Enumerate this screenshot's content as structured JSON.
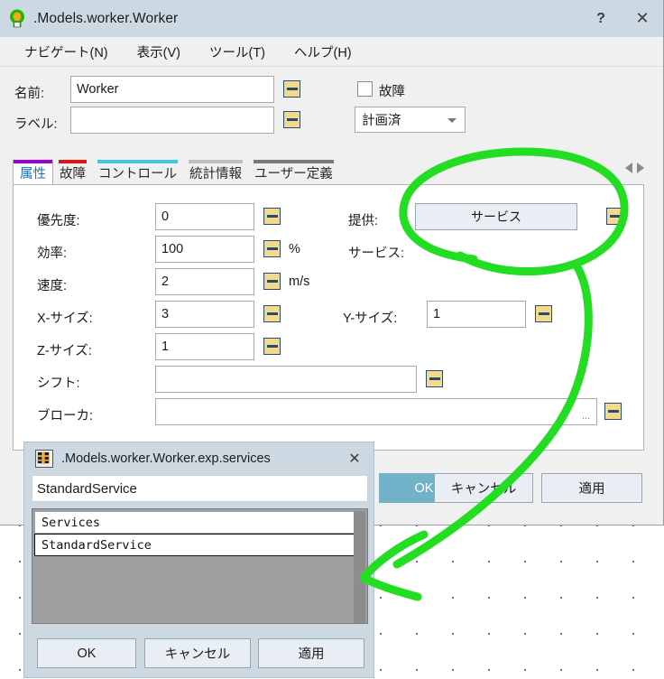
{
  "window": {
    "title": ".Models.worker.Worker",
    "icon": "worker-green-icon",
    "help_label": "?",
    "close_label": "✕"
  },
  "menubar": {
    "items": [
      {
        "label": "ナビゲート(N)"
      },
      {
        "label": "表示(V)"
      },
      {
        "label": "ツール(T)"
      },
      {
        "label": "ヘルプ(H)"
      }
    ]
  },
  "topform": {
    "name_label": "名前:",
    "name_value": "Worker",
    "label_label": "ラベル:",
    "label_value": "",
    "failure_checkbox_label": "故障",
    "failure_checked": false,
    "status_dropdown_value": "計画済"
  },
  "tabs": [
    {
      "label": "属性",
      "color": "#9a00d4",
      "active": true
    },
    {
      "label": "故障",
      "color": "#e81010",
      "active": false
    },
    {
      "label": "コントロール",
      "color": "#44c2e8",
      "active": false
    },
    {
      "label": "統計情報",
      "color": "#bfbfbf",
      "active": false
    },
    {
      "label": "ユーザー定義",
      "color": "#7a7a7a",
      "active": false
    }
  ],
  "tabnav": {
    "prev": "prev-tab",
    "next": "next-tab"
  },
  "attributes": {
    "fields": [
      {
        "label": "優先度:",
        "value": "0",
        "unit": ""
      },
      {
        "label": "効率:",
        "value": "100",
        "unit": "%"
      },
      {
        "label": "速度:",
        "value": "2",
        "unit": "m/s"
      },
      {
        "label": "X-サイズ:",
        "value": "3",
        "unit": ""
      },
      {
        "label": "Z-サイズ:",
        "value": "1",
        "unit": ""
      },
      {
        "label": "シフト:",
        "value": "",
        "unit": ""
      },
      {
        "label": "ブローカ:",
        "value": "",
        "unit": ""
      }
    ],
    "ysize_label": "Y-サイズ:",
    "ysize_value": "1",
    "provide_label": "提供:",
    "provide_button": "サービス",
    "service_label": "サービス:",
    "service_value": "-",
    "broker_ellipsis": "..."
  },
  "main_buttons": {
    "ok": "OK",
    "cancel": "キャンセル",
    "apply": "適用"
  },
  "child_dialog": {
    "icon": "table-grid-icon",
    "title": ".Models.worker.Worker.exp.services",
    "close_label": "✕",
    "input_value": "StandardService",
    "list": [
      {
        "label": "Services",
        "selected": false
      },
      {
        "label": "StandardService",
        "selected": true
      }
    ],
    "buttons": {
      "ok": "OK",
      "cancel": "キャンセル",
      "apply": "適用"
    }
  },
  "annotation": {
    "color": "#22dd22",
    "description": "green-circle-and-arrow-highlight"
  }
}
